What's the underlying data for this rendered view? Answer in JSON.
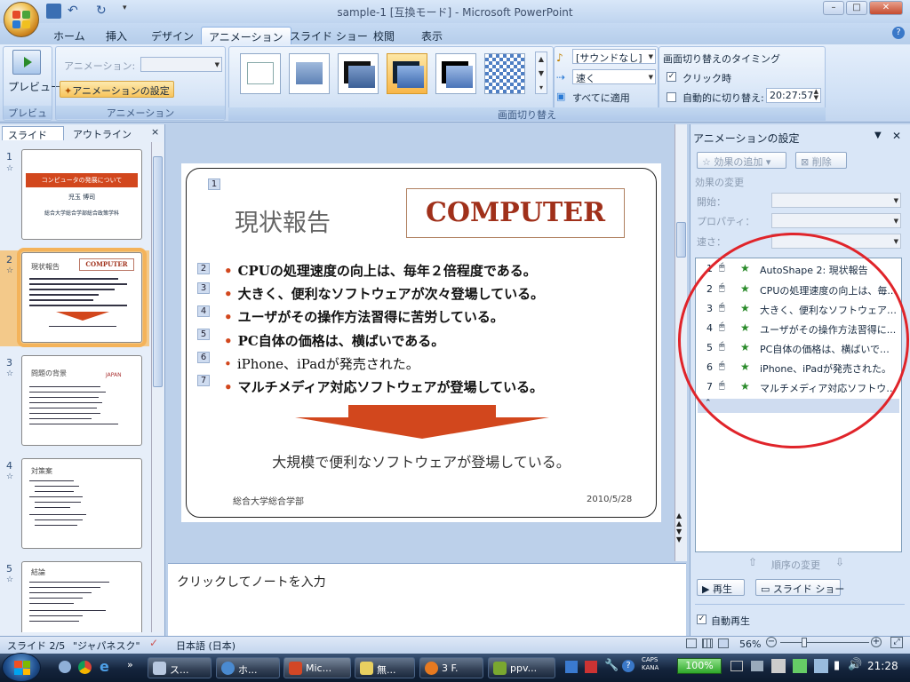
{
  "window": {
    "title": "sample-1 [互換モード] - Microsoft PowerPoint",
    "min": "–",
    "max": "□",
    "close": "✕"
  },
  "tabs": [
    "ホーム",
    "挿入",
    "デザイン",
    "アニメーション",
    "スライド ショー",
    "校閲",
    "表示"
  ],
  "ribbon": {
    "preview_label": "プレビュー",
    "group_preview": "プレビュー",
    "anim_label": "アニメーション:",
    "anim_settings": "アニメーションの設定",
    "group_animation": "アニメーション",
    "sound": "[サウンドなし]",
    "speed": "速く",
    "apply_all": "すべてに適用",
    "timing_title": "画面切り替えのタイミング",
    "on_click": "クリック時",
    "auto_after": "自動的に切り替え:",
    "auto_time": "20:27:57",
    "group_transition": "画面切り替え"
  },
  "leftpane": {
    "tab_slides": "スライド",
    "tab_outline": "アウトライン",
    "close": "×",
    "thumbs": [
      {
        "num": "1",
        "title": "コンピュータの発展について",
        "line1": "児玉 博司",
        "line2": "総合大学総合学部総合政策学科"
      },
      {
        "num": "2",
        "title": "現状報告",
        "badge": "COMPUTER"
      },
      {
        "num": "3",
        "title": "問題の背景",
        "badge": "JAPAN"
      },
      {
        "num": "4",
        "title": "対策案"
      },
      {
        "num": "5",
        "title": "結論"
      }
    ]
  },
  "slide": {
    "title_tag": "1",
    "title": "現状報告",
    "logo": "COMPUTER",
    "bullets": [
      {
        "tag": "2",
        "text": "CPUの処理速度の向上は、毎年２倍程度である。"
      },
      {
        "tag": "3",
        "text": "大きく、便利なソフトウェアが次々登場している。"
      },
      {
        "tag": "4",
        "text": "ユーザがその操作方法習得に苦労している。"
      },
      {
        "tag": "5",
        "text": "PC自体の価格は、横ばいである。"
      },
      {
        "tag": "6",
        "text": "iPhone、iPadが発売された。"
      },
      {
        "tag": "7",
        "text": "マルチメディア対応ソフトウェアが登場している。"
      }
    ],
    "conclusion": "大規模で便利なソフトウェアが登場している。",
    "footer_left": "総合大学総合学部",
    "footer_right": "2010/5/28"
  },
  "notes": {
    "placeholder": "クリックしてノートを入力"
  },
  "anim": {
    "title": "アニメーションの設定",
    "add_effect": "効果の追加",
    "remove": "削除",
    "change_effect": "効果の変更",
    "start": "開始：",
    "property": "プロパティ：",
    "speed": "速さ：",
    "items": [
      {
        "n": "1",
        "t": "AutoShape 2: 現状報告"
      },
      {
        "n": "2",
        "t": "CPUの処理速度の向上は、毎..."
      },
      {
        "n": "3",
        "t": "大きく、便利なソフトウェアが次..."
      },
      {
        "n": "4",
        "t": "ユーザがその操作方法習得に..."
      },
      {
        "n": "5",
        "t": "PC自体の価格は、横ばいであ..."
      },
      {
        "n": "6",
        "t": "iPhone、iPadが発売された。"
      },
      {
        "n": "7",
        "t": "マルチメディア対応ソフトウェアが..."
      }
    ],
    "reorder": "順序の変更",
    "play": "再生",
    "slideshow": "スライド ショー",
    "autopreview": "自動再生"
  },
  "status": {
    "slide": "スライド 2/5",
    "theme": "\"ジャパネスク\"",
    "lang": "日本語 (日本)",
    "zoom": "56%"
  },
  "taskbar": {
    "items": [
      "ス...",
      "ホ...",
      "Mic...",
      "無...",
      "3 F.",
      "ppv..."
    ],
    "battery": "100%",
    "caps": "CAPS",
    "kana": "KANA",
    "clock": "21:28"
  },
  "colors": {
    "accent": "#d2471d",
    "ribbon": "#cfe0f5",
    "highlight": "#f4b35a",
    "circle": "#e0242a"
  }
}
